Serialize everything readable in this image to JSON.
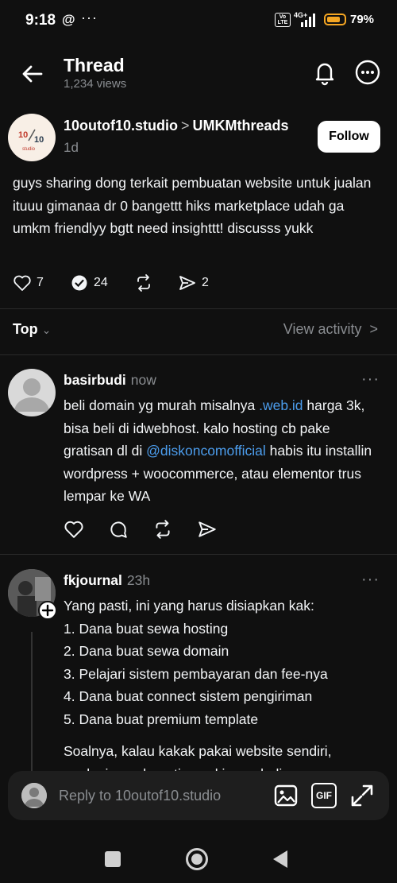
{
  "status_bar": {
    "time": "9:18",
    "threads_icon": "threads-icon",
    "dots": "···",
    "volte": "Vo LTE",
    "network": "4G+",
    "battery_pct": "79%",
    "battery_level": 0.79,
    "battery_color": "#f5a623"
  },
  "header": {
    "title": "Thread",
    "views": "1,234 views"
  },
  "post": {
    "author": "10outof10.studio",
    "community": "UMKMthreads",
    "time": "1d",
    "follow_label": "Follow",
    "body": "guys sharing dong terkait pembuatan website untuk jualan ituuu gimanaa dr 0 bangettt hiks marketplace udah ga umkm friendlyy bgtt need insighttt! discusss yukk",
    "likes": "7",
    "replies": "24",
    "shares": "2"
  },
  "sort": {
    "label": "Top",
    "view_activity": "View activity"
  },
  "replies": [
    {
      "author": "basirbudi",
      "time": "now",
      "body_parts": [
        "beli domain yg murah misalnya ",
        ".web.id",
        " harga 3k, bisa beli di idwebhost. kalo hosting cb pake gratisan dl di ",
        "@diskoncomofficial",
        " habis itu installin wordpress + woocommerce, atau elementor trus lempar ke WA"
      ]
    },
    {
      "author": "fkjournal",
      "time": "23h",
      "intro": "Yang pasti, ini yang harus disiapkan kak:",
      "list": [
        "1. Dana buat sewa hosting",
        "2. Dana buat sewa domain",
        "3. Pelajari sistem pembayaran dan fee-nya",
        "4. Dana buat connect sistem pengiriman",
        "5. Dana buat premium template"
      ],
      "outro": "Soalnya, kalau kakak pakai website sendiri,",
      "outro_cut": "analogi nggak gratis ongkir pembeli"
    }
  ],
  "reply_bar": {
    "placeholder": "Reply to 10outof10.studio",
    "gif_label": "GIF"
  },
  "colors": {
    "background": "#101010",
    "link": "#4c9ded",
    "muted": "#8a8d91"
  }
}
